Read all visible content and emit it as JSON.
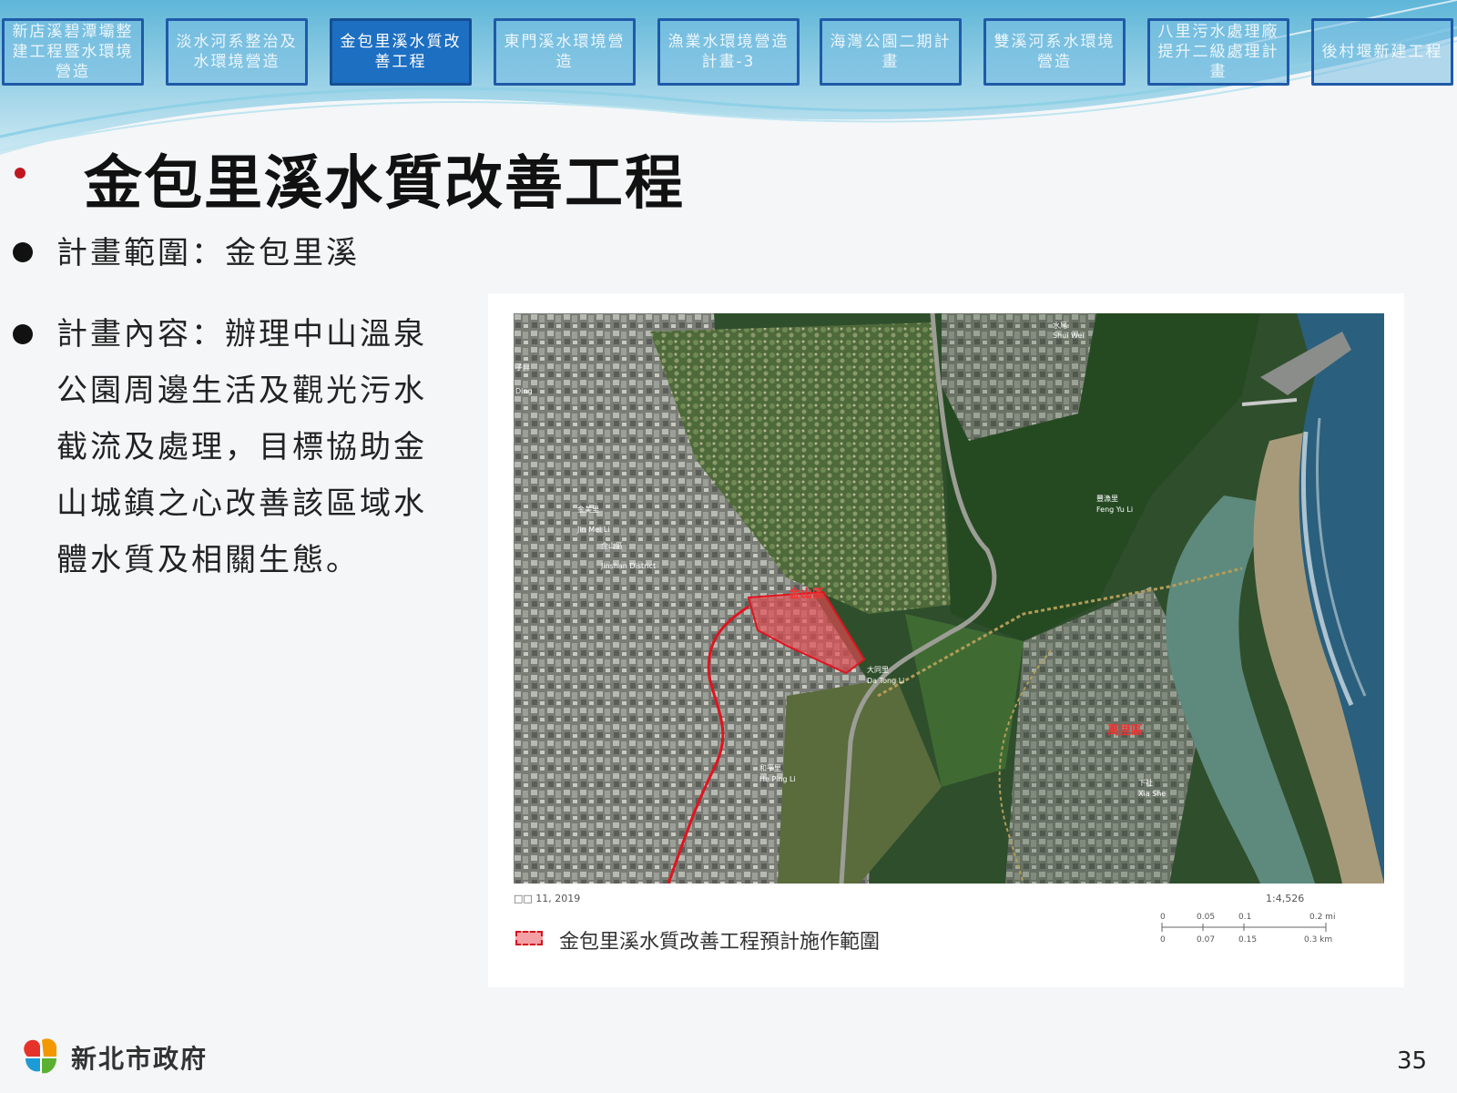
{
  "nav": {
    "tabs": [
      {
        "label": "新店溪碧潭壩整建工程暨水環境營造",
        "active": false
      },
      {
        "label": "淡水河系整治及水環境營造",
        "active": false
      },
      {
        "label": "金包里溪水質改善工程",
        "active": true
      },
      {
        "label": "東門溪水環境營造",
        "active": false
      },
      {
        "label": "漁業水環境營造計畫-3",
        "active": false
      },
      {
        "label": "海灣公園二期計畫",
        "active": false
      },
      {
        "label": "雙溪河系水環境營造",
        "active": false
      },
      {
        "label": "八里污水處理廠提升二級處理計畫",
        "active": false
      },
      {
        "label": "後村堰新建工程",
        "active": false
      }
    ]
  },
  "page": {
    "title": "金包里溪水質改善工程",
    "bullets": [
      {
        "text": "計畫範圍：金包里溪"
      },
      {
        "text": "計畫內容：辦理中山溫泉公園周邊生活及觀光污水截流及處理，目標協助金山城鎮之心改善該區域水體水質及相關生態。"
      }
    ]
  },
  "map": {
    "labels": {
      "jinshan": "金山區",
      "wanli": "萬里區",
      "shuiwei": "水尾",
      "shuiwei_en": "Shui Wei",
      "fengyu": "豐漁里",
      "fengyu_en": "Feng Yu Li",
      "meili": "金美里",
      "meili_en": "Jin Mei Li",
      "jinshan_cn": "金山區",
      "jinshan_en": "Jinshan District",
      "datong": "大同里",
      "datong_en": "Da Tong Li",
      "heping": "和平里",
      "heping_en": "He Ping Li",
      "xiashe": "下社",
      "xiashe_en": "Xia She",
      "zihsing": "子興",
      "zihsing_en": "Ding"
    },
    "date": "□□ 11, 2019",
    "scale_ratio": "1:4,526",
    "scale_mi": [
      "0",
      "0.05",
      "0.1",
      "0.2 mi"
    ],
    "scale_km": [
      "0",
      "0.07",
      "0.15",
      "0.3 km"
    ],
    "legend_label": "金包里溪水質改善工程預計施作範圍",
    "colors": {
      "boundary": "#e0141e",
      "fill": "#e84a52"
    }
  },
  "footer": {
    "org": "新北市政府",
    "page_number": "35"
  },
  "theme": {
    "accent": "#1d6fc2",
    "tab_border": "#1f5aa8",
    "title_dot": "#c0161f"
  }
}
